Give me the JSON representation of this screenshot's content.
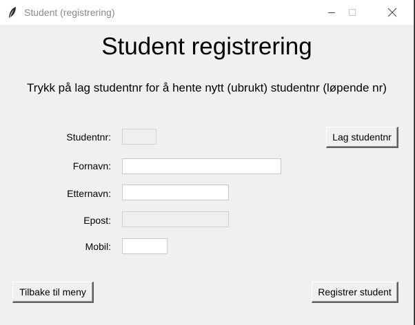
{
  "window": {
    "title": "Student (registrering)"
  },
  "form": {
    "heading": "Student registrering",
    "instruction": "Trykk på lag studentnr for å hente nytt (ubrukt) studentnr (løpende nr)",
    "fields": {
      "studentnr": {
        "label": "Studentnr:",
        "value": ""
      },
      "fornavn": {
        "label": "Fornavn:",
        "value": ""
      },
      "etternavn": {
        "label": "Etternavn:",
        "value": ""
      },
      "epost": {
        "label": "Epost:",
        "value": ""
      },
      "mobil": {
        "label": "Mobil:",
        "value": ""
      }
    }
  },
  "buttons": {
    "lag_studentnr": "Lag studentnr",
    "tilbake": "Tilbake til meny",
    "registrer": "Registrer student"
  }
}
